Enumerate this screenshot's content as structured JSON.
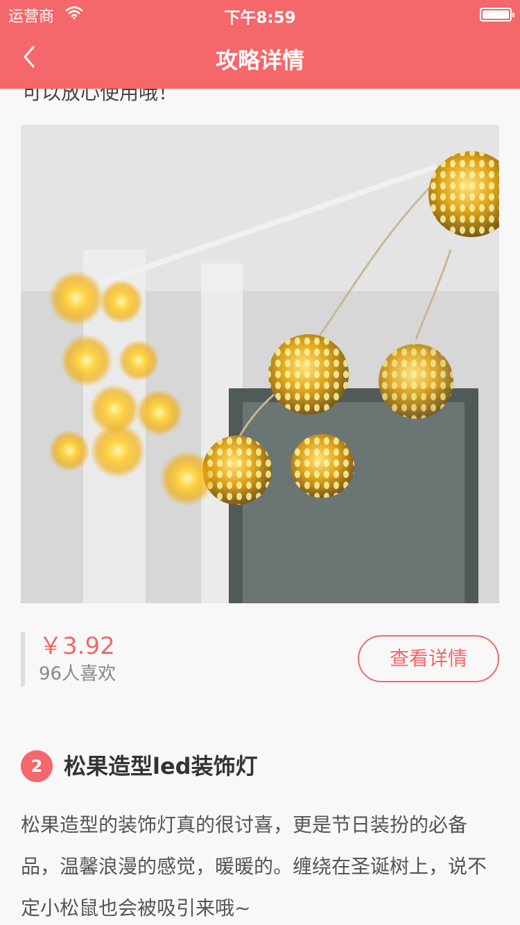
{
  "status_bar": {
    "carrier": "运营商",
    "time": "下午8:59"
  },
  "nav": {
    "title": "攻略详情"
  },
  "content": {
    "prev_text_tail": "可以放心使用哦！",
    "product": {
      "price": "￥3.92",
      "likes": "96人喜欢",
      "detail_button": "查看详情"
    },
    "item": {
      "number": "2",
      "title": "松果造型led装饰灯",
      "description": "松果造型的装饰灯真的很讨喜，更是节日装扮的必备品，温馨浪漫的感觉，暖暖的。缠绕在圣诞树上，说不定小松鼠也会被吸引来哦~"
    }
  },
  "colors": {
    "accent": "#f4676a",
    "background": "#f8f8f8"
  },
  "icons": {
    "back": "chevron-left-icon",
    "wifi": "wifi-icon",
    "battery": "battery-icon"
  }
}
